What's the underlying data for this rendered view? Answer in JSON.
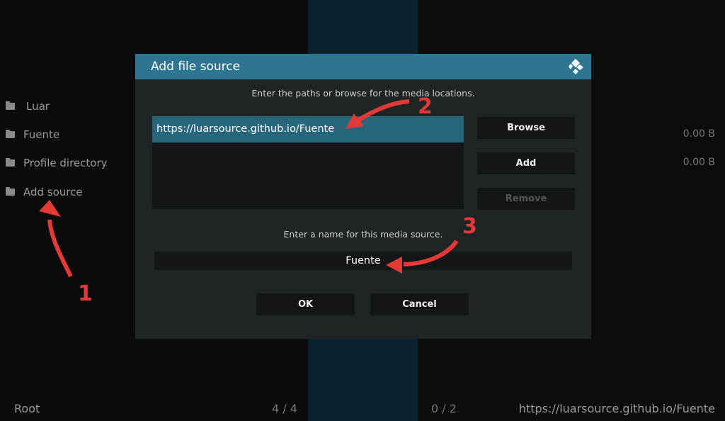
{
  "background": {
    "items": [
      {
        "label": "Luar",
        "size": ""
      },
      {
        "label": "Fuente",
        "size": "0.00 B"
      },
      {
        "label": "Profile directory",
        "size": "0.00 B"
      },
      {
        "label": "Add source",
        "size": ""
      }
    ]
  },
  "footer": {
    "left": "Root",
    "count1": "4 / 4",
    "count2": "0 / 2",
    "path": "https://luarsource.github.io/Fuente"
  },
  "dialog": {
    "title": "Add file source",
    "paths_hint": "Enter the paths or browse for the media locations.",
    "paths": [
      "https://luarsource.github.io/Fuente"
    ],
    "browse": "Browse",
    "add": "Add",
    "remove": "Remove",
    "name_hint": "Enter a name for this media source.",
    "name_value": "Fuente",
    "ok": "OK",
    "cancel": "Cancel"
  },
  "annotations": [
    "1",
    "2",
    "3"
  ],
  "colors": {
    "header": "#2c7691",
    "selected": "#28667c",
    "arrow": "#e53935"
  }
}
